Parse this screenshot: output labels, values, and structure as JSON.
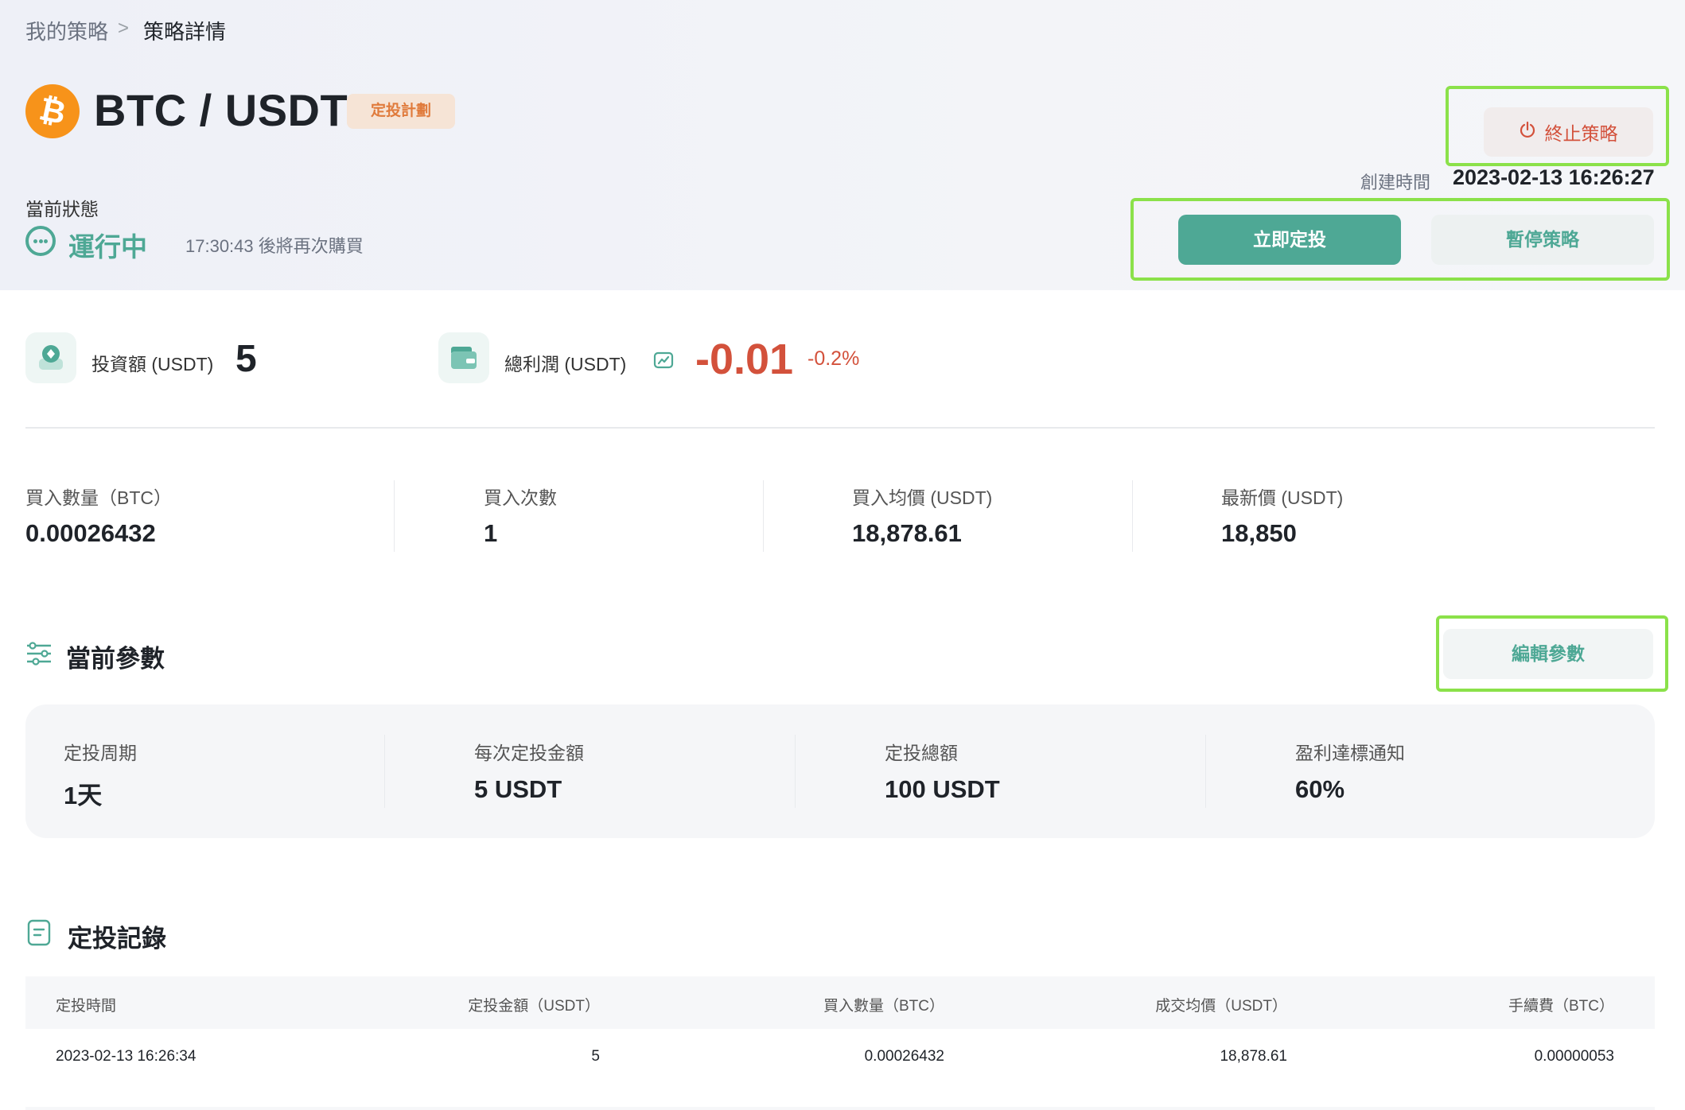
{
  "breadcrumb": {
    "parent": "我的策略",
    "separator": ">",
    "current": "策略詳情"
  },
  "header": {
    "pair": "BTC / USDT",
    "coin_icon": "bitcoin-icon",
    "tag": "定投計劃",
    "stop_label": "終止策略",
    "created_label": "創建時間",
    "created_value": "2023-02-13 16:26:27"
  },
  "status": {
    "label": "當前狀態",
    "value": "運行中",
    "next_purchase": "17:30:43 後將再次購買"
  },
  "actions": {
    "invest_now": "立即定投",
    "pause": "暫停策略"
  },
  "summary": {
    "investment_label": "投資額 (USDT)",
    "investment_value": "5",
    "profit_label": "總利潤 (USDT)",
    "profit_value": "-0.01",
    "profit_pct": "-0.2%"
  },
  "stats": [
    {
      "label": "買入數量（BTC）",
      "value": "0.00026432"
    },
    {
      "label": "買入次數",
      "value": "1"
    },
    {
      "label": "買入均價 (USDT)",
      "value": "18,878.61"
    },
    {
      "label": "最新價 (USDT)",
      "value": "18,850"
    }
  ],
  "params_section": {
    "title": "當前參數",
    "edit_label": "編輯參數",
    "items": [
      {
        "label": "定投周期",
        "value": "1天"
      },
      {
        "label": "每次定投金額",
        "value": "5 USDT"
      },
      {
        "label": "定投總額",
        "value": "100 USDT"
      },
      {
        "label": "盈利達標通知",
        "value": "60%"
      }
    ]
  },
  "records": {
    "title": "定投記錄",
    "columns": [
      "定投時間",
      "定投金額（USDT）",
      "買入數量（BTC）",
      "成交均價（USDT）",
      "手續費（BTC）"
    ],
    "rows": [
      [
        "2023-02-13 16:26:34",
        "5",
        "0.00026432",
        "18,878.61",
        "0.00000053"
      ]
    ]
  },
  "colors": {
    "accent": "#4ea895",
    "negative": "#d3513b",
    "coin": "#f7931a",
    "highlight": "#8be14a"
  }
}
